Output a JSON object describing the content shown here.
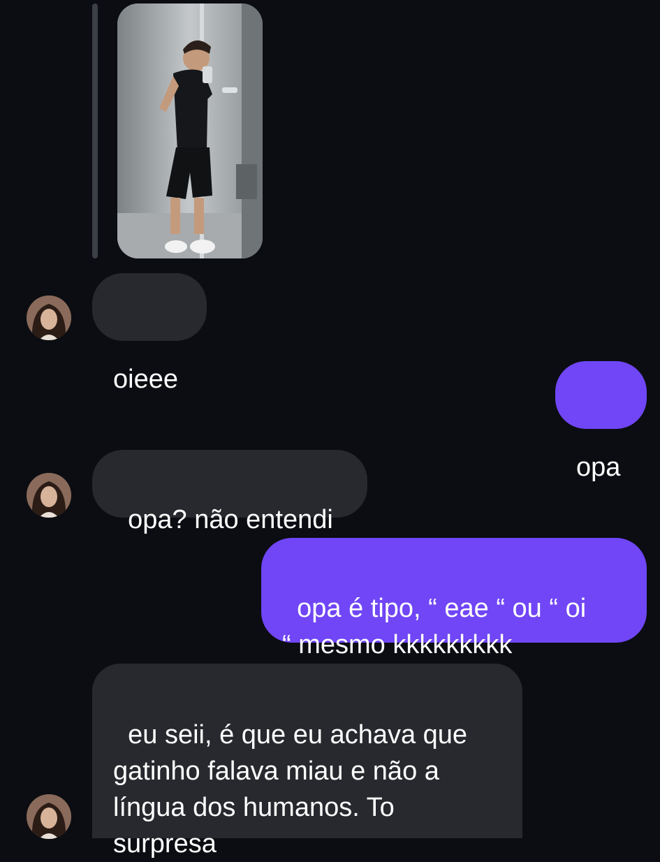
{
  "conversation": {
    "messages": [
      {
        "sender": "contact",
        "text": "oieee"
      },
      {
        "sender": "me",
        "text": "opa"
      },
      {
        "sender": "contact",
        "text": "opa? não entendi"
      },
      {
        "sender": "me",
        "text": "opa é tipo, “ eae “ ou “ oi\n“ mesmo kkkkkkkkk"
      },
      {
        "sender": "contact",
        "text": "eu seii, é que eu achava que\ngatinho falava miau e não a\nlíngua dos humanos. To\nsurpresa"
      }
    ]
  },
  "colors": {
    "background": "#0b0d12",
    "incoming_bubble": "#27292e",
    "outgoing_bubble": "#7046f6",
    "text": "#ffffff"
  },
  "icons": {
    "avatar": "contact-profile-photo",
    "story": "mirror-selfie-photo"
  }
}
